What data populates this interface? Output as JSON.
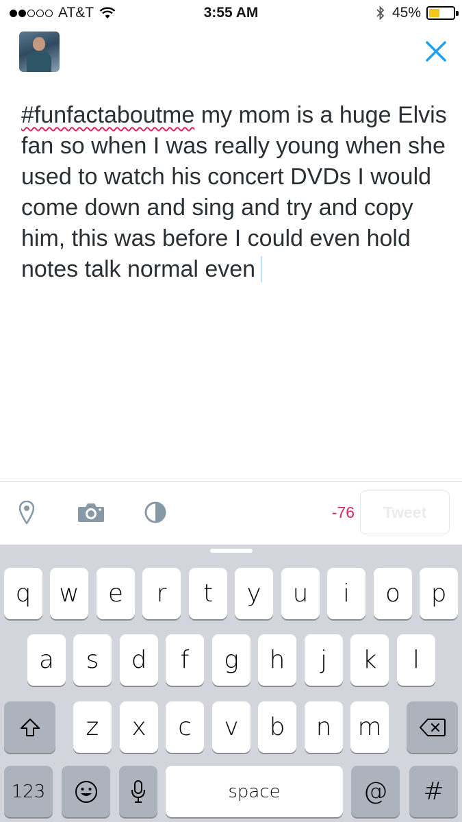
{
  "status_bar": {
    "carrier": "AT&T",
    "time": "3:55 AM",
    "battery": "45%",
    "battery_level": 0.45,
    "signal_bars_filled": 2,
    "signal_bars_total": 5
  },
  "compose": {
    "hashtag": "#funfactaboutme",
    "text": " my mom is a huge Elvis fan so when I was really young when she used to watch his concert DVDs I would come down and sing and try and copy him, this was before I could even hold notes talk normal even"
  },
  "toolbar": {
    "char_count": "-76",
    "tweet_label": "Tweet",
    "icons": [
      "location-pin-icon",
      "camera-icon",
      "poll-icon"
    ]
  },
  "keyboard": {
    "row1": [
      "q",
      "w",
      "e",
      "r",
      "t",
      "y",
      "u",
      "i",
      "o",
      "p"
    ],
    "row2": [
      "a",
      "s",
      "d",
      "f",
      "g",
      "h",
      "j",
      "k",
      "l"
    ],
    "row3": [
      "z",
      "x",
      "c",
      "v",
      "b",
      "n",
      "m"
    ],
    "numbers_label": "123",
    "space_label": "space",
    "at_label": "@",
    "hash_label": "#"
  },
  "colors": {
    "accent": "#1da1f2",
    "counter_negative": "#e0245e",
    "keyboard_bg": "#d2d5db",
    "battery": "#f5c518"
  }
}
